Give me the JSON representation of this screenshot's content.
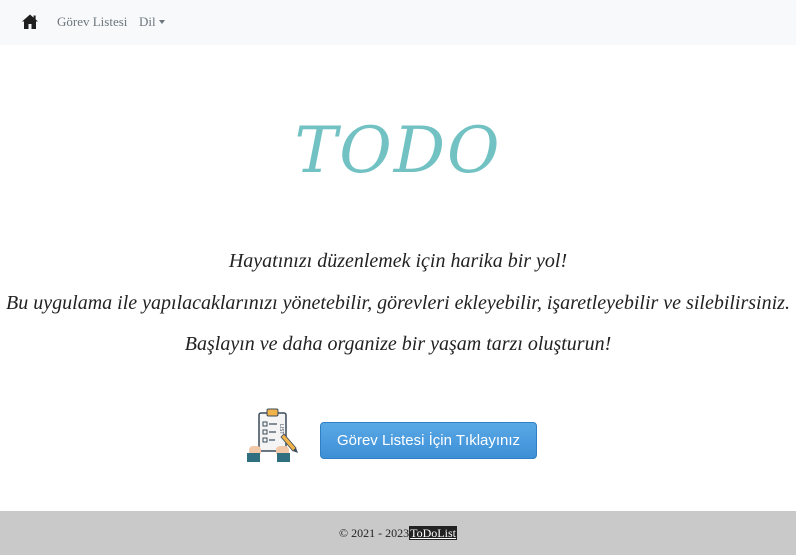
{
  "navbar": {
    "home_icon": "home-icon",
    "items": [
      {
        "label": "Görev Listesi"
      },
      {
        "label": "Dil"
      }
    ]
  },
  "hero": {
    "title": "TODO",
    "lines": [
      "Hayatınızı düzenlemek için harika bir yol!",
      "Bu uygulama ile yapılacaklarınızı yönetebilir, görevleri ekleyebilir, işaretleyebilir ve silebilirsiniz.",
      "Başlayın ve daha organize bir yaşam tarzı oluşturun!"
    ]
  },
  "cta": {
    "illustration_icon": "task-list-clipboard-icon",
    "illustration_text": "LIST",
    "button_label": "Görev Listesi İçin Tıklayınız"
  },
  "footer": {
    "copyright": "© 2021 - 2023",
    "brand_link": "ToDoList"
  },
  "colors": {
    "title_teal": "#72c2c3",
    "button_blue": "#4a9ee0",
    "navbar_bg": "#f8f9fa",
    "footer_bg": "#c9c9c9"
  }
}
